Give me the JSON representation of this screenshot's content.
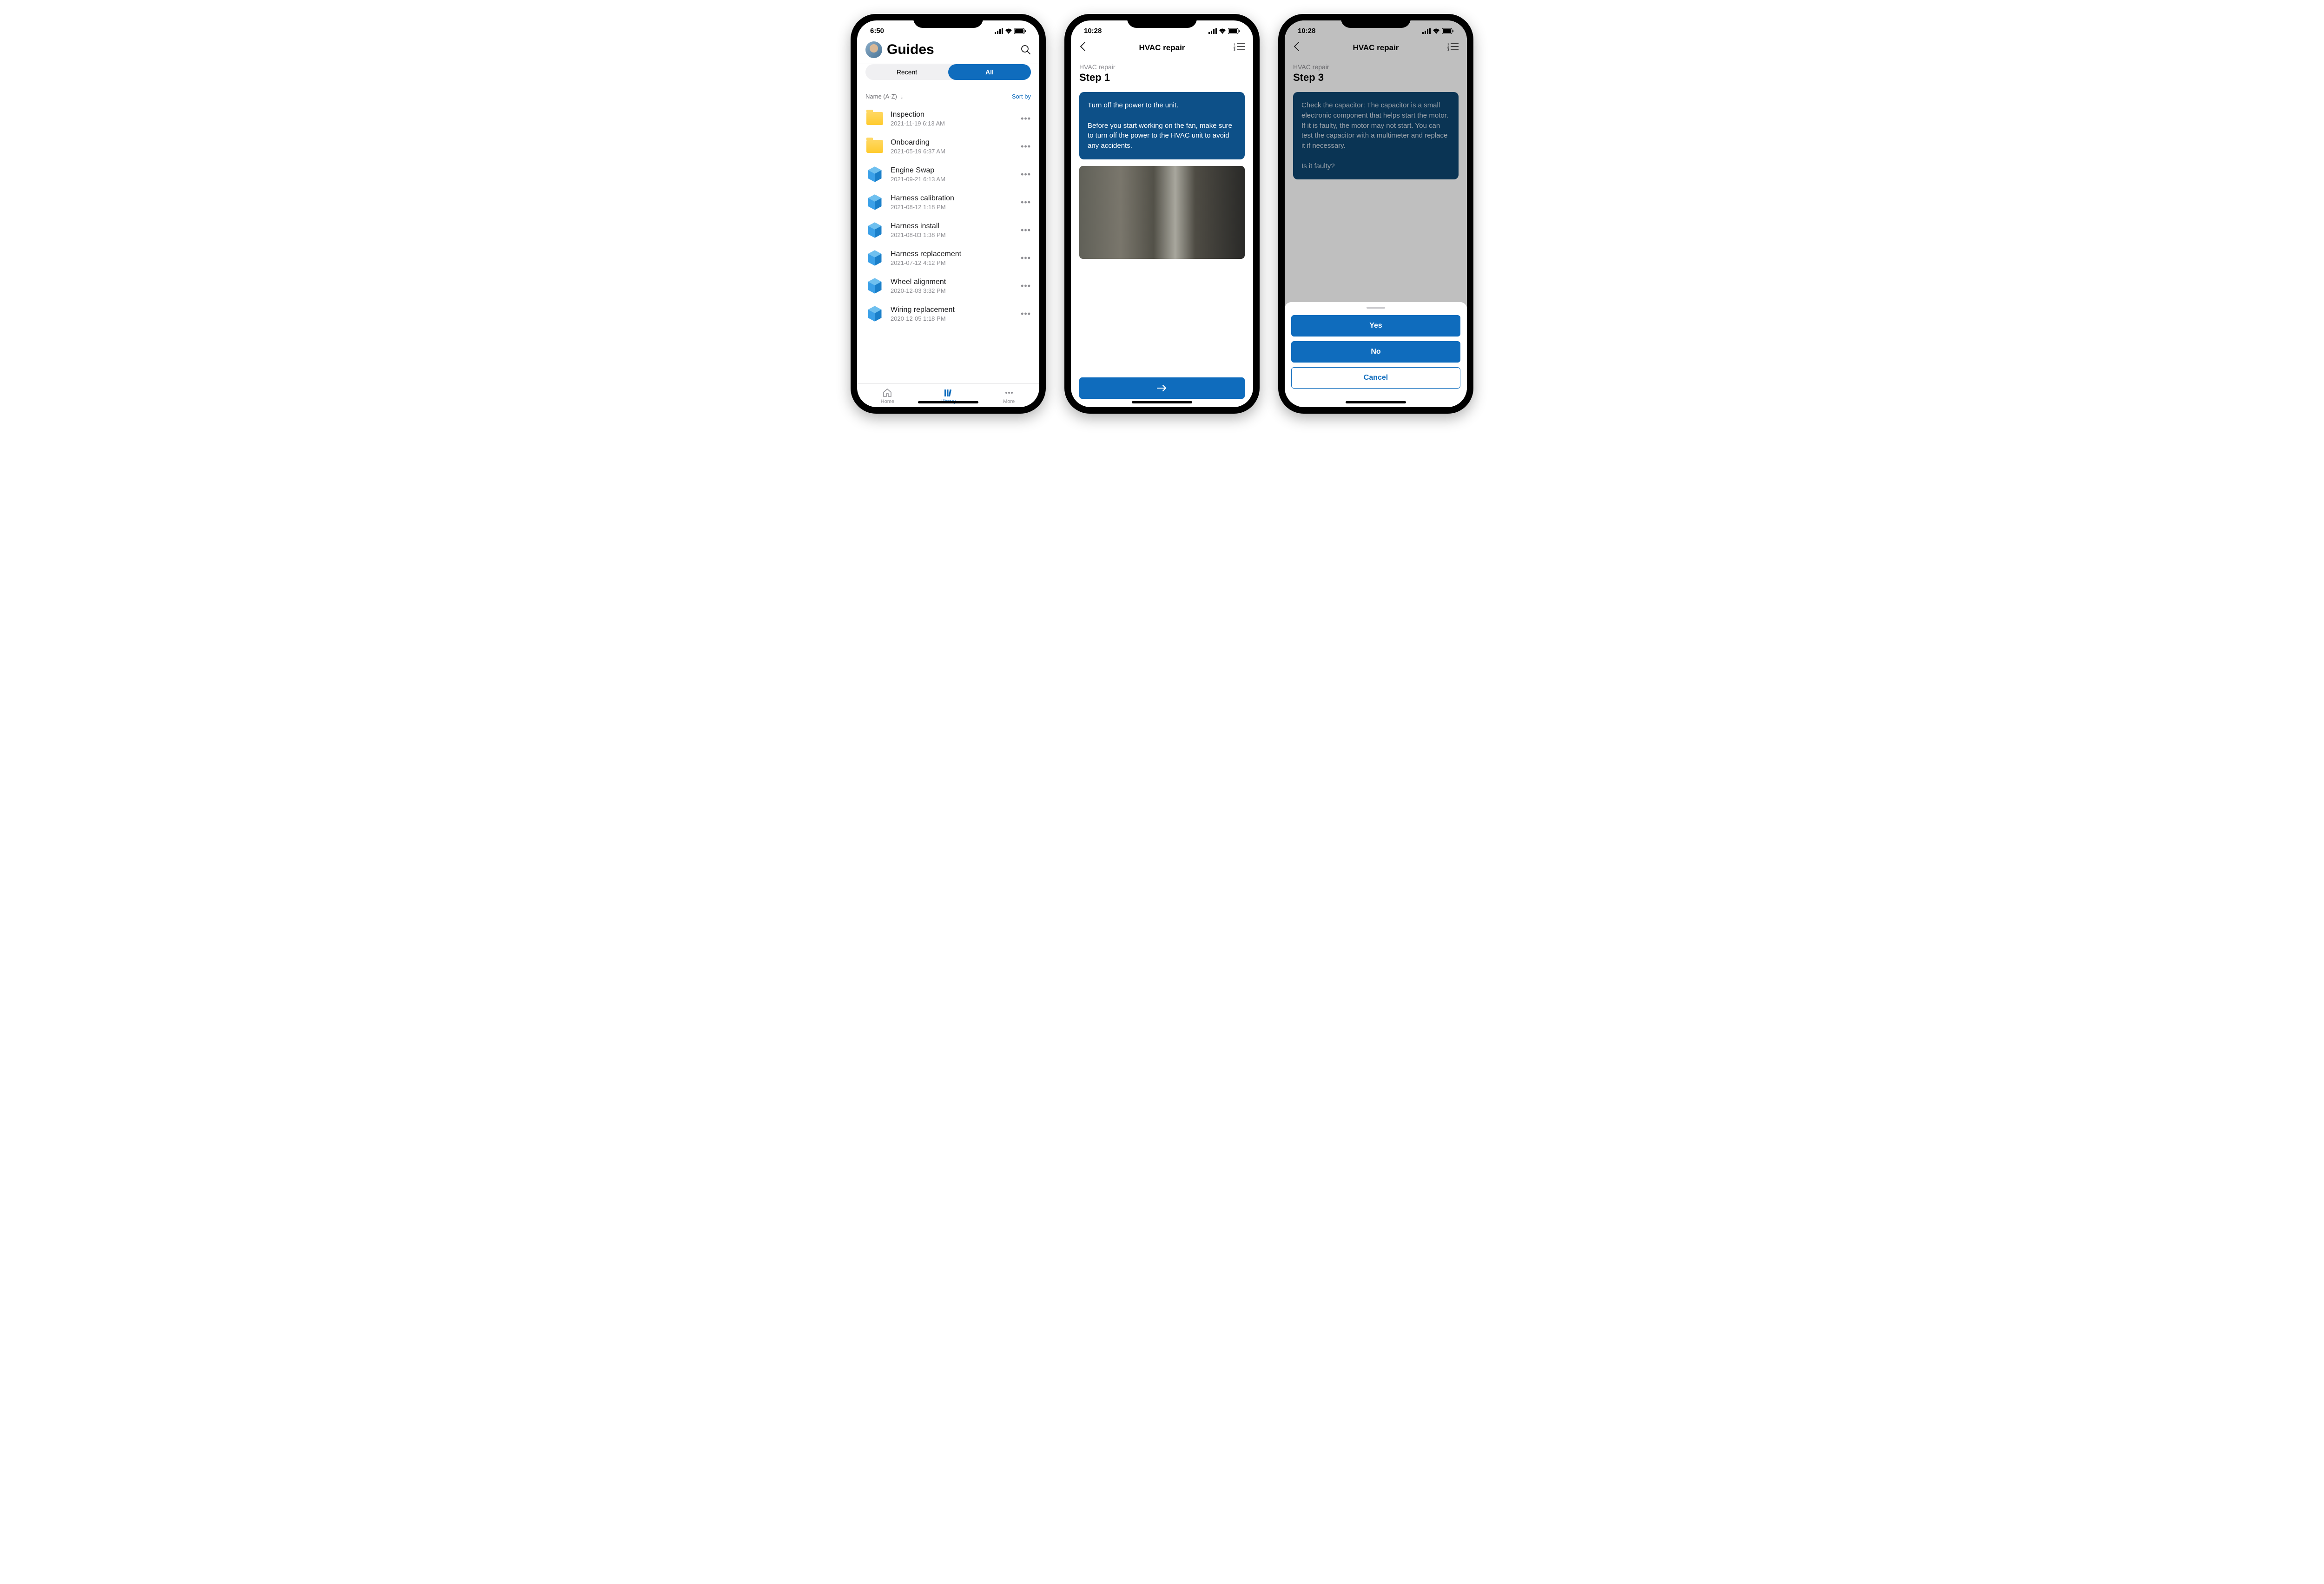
{
  "screen1": {
    "status_time": "6:50",
    "title": "Guides",
    "segment": {
      "recent": "Recent",
      "all": "All"
    },
    "sort_label": "Name (A-Z)",
    "sort_by": "Sort by",
    "items": [
      {
        "type": "folder",
        "name": "Inspection",
        "date": "2021-11-19 6:13 AM"
      },
      {
        "type": "folder",
        "name": "Onboarding",
        "date": "2021-05-19 6:37 AM"
      },
      {
        "type": "guide",
        "name": "Engine Swap",
        "date": "2021-09-21 6:13 AM"
      },
      {
        "type": "guide",
        "name": "Harness calibration",
        "date": "2021-08-12 1:18 PM"
      },
      {
        "type": "guide",
        "name": "Harness install",
        "date": "2021-08-03 1:38 PM"
      },
      {
        "type": "guide",
        "name": "Harness replacement",
        "date": "2021-07-12 4:12 PM"
      },
      {
        "type": "guide",
        "name": "Wheel alignment",
        "date": "2020-12-03 3:32 PM"
      },
      {
        "type": "guide",
        "name": "Wiring replacement",
        "date": "2020-12-05 1:18 PM"
      }
    ],
    "tabs": {
      "home": "Home",
      "library": "Library",
      "more": "More"
    }
  },
  "screen2": {
    "status_time": "10:28",
    "header": "HVAC repair",
    "breadcrumb": "HVAC repair",
    "step": "Step 1",
    "instruction": "Turn off the power to the unit.\n\nBefore you start working on the fan, make sure to turn off the power to the HVAC unit to avoid any accidents."
  },
  "screen3": {
    "status_time": "10:28",
    "header": "HVAC repair",
    "breadcrumb": "HVAC repair",
    "step": "Step 3",
    "instruction": "Check the capacitor: The capacitor is a small electronic component that helps start the motor. If it is faulty, the motor may not start. You can test the capacitor with a multimeter and replace it if necessary.\n\nIs it faulty?",
    "sheet": {
      "yes": "Yes",
      "no": "No",
      "cancel": "Cancel"
    }
  }
}
